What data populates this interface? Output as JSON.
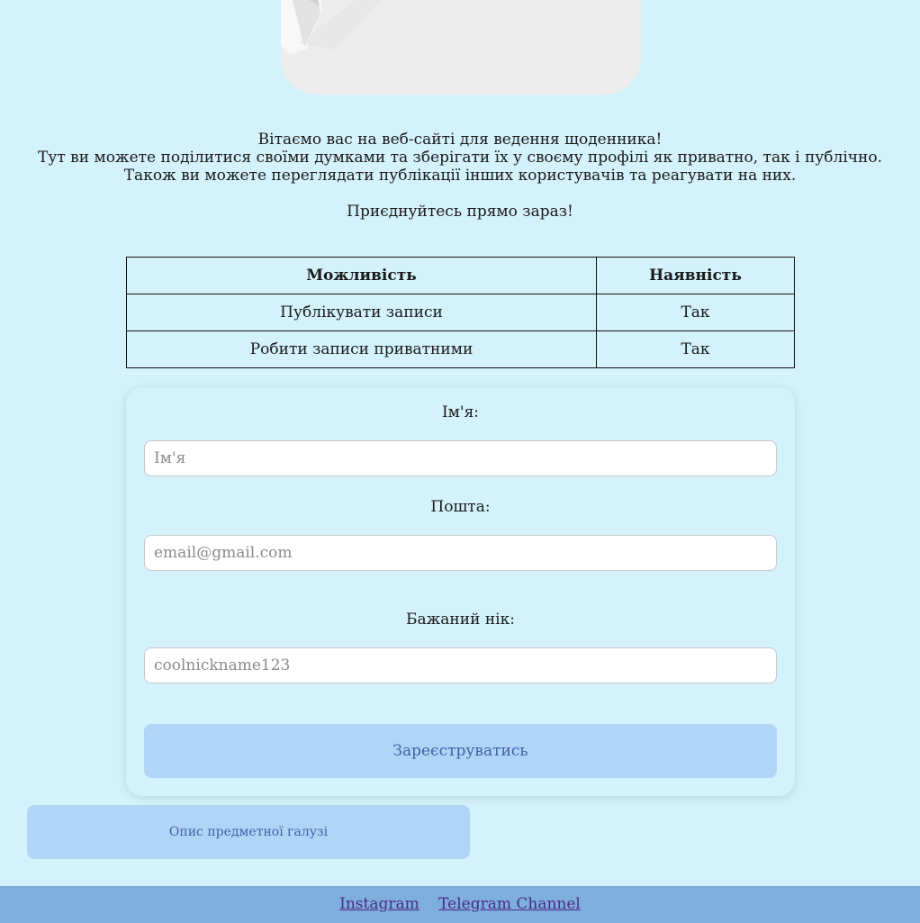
{
  "hero": {
    "image_icon": "hero-photo"
  },
  "intro": {
    "line1": "Вітаємо вас на веб-сайті для ведення щоденника!",
    "line2": "Тут ви можете поділитися своїми думками та зберігати їх у своєму профілі як приватно, так і публічно.",
    "line3": "Також ви можете переглядати публікації інших користувачів та реагувати на них.",
    "cta": "Приєднуйтесь прямо зараз!"
  },
  "features_table": {
    "headers": [
      "Можливість",
      "Наявність"
    ],
    "rows": [
      [
        "Публікувати записи",
        "Так"
      ],
      [
        "Робити записи приватними",
        "Так"
      ]
    ]
  },
  "form": {
    "name_label": "Ім'я:",
    "name_placeholder": "Ім'я",
    "email_label": "Пошта:",
    "email_placeholder": "email@gmail.com",
    "nick_label": "Бажаний нік:",
    "nick_placeholder": "coolnickname123",
    "submit_label": "Зареєструватись"
  },
  "domain_button_label": "Опис предметної галузі",
  "footer": {
    "links": [
      "Instagram",
      "Telegram Channel"
    ]
  },
  "colors": {
    "background": "#d4f2fb",
    "button": "#b1d5f6",
    "button_text": "#3f5fa6",
    "footer": "#7eaedb",
    "link": "#4b2a8a"
  }
}
